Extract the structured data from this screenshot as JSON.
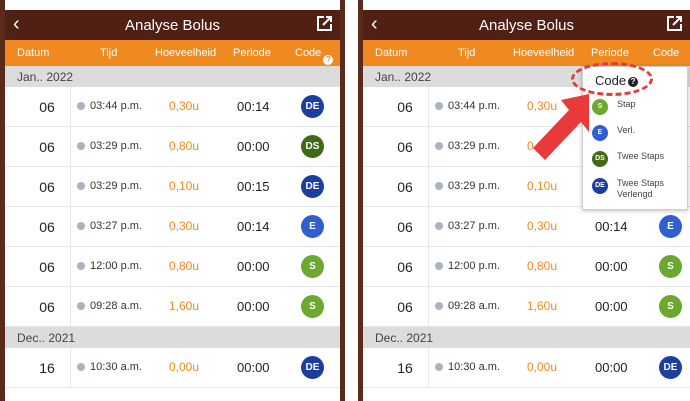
{
  "screens": [
    {
      "title": "Analyse Bolus",
      "headers": {
        "date": "Datum",
        "time": "Tijd",
        "amount": "Hoeveelheid",
        "period": "Periode",
        "code": "Code"
      },
      "sections": [
        {
          "label": "Jan.. 2022",
          "rows": [
            {
              "day": "06",
              "time": "03:44 p.m.",
              "amount": "0,30u",
              "period": "00:14",
              "code": "DE"
            },
            {
              "day": "06",
              "time": "03:29 p.m.",
              "amount": "0,80u",
              "period": "00:00",
              "code": "DS"
            },
            {
              "day": "06",
              "time": "03:29 p.m.",
              "amount": "0,10u",
              "period": "00:15",
              "code": "DE"
            },
            {
              "day": "06",
              "time": "03:27 p.m.",
              "amount": "0,30u",
              "period": "00:14",
              "code": "E"
            },
            {
              "day": "06",
              "time": "12:00 p.m.",
              "amount": "0,80u",
              "period": "00:00",
              "code": "S"
            },
            {
              "day": "06",
              "time": "09:28 a.m.",
              "amount": "1,60u",
              "period": "00:00",
              "code": "S"
            }
          ]
        },
        {
          "label": "Dec.. 2021",
          "rows": [
            {
              "day": "16",
              "time": "10:30 a.m.",
              "amount": "0,00u",
              "period": "00:00",
              "code": "DE"
            }
          ]
        }
      ]
    },
    {
      "title": "Analyse Bolus",
      "headers": {
        "date": "Datum",
        "time": "Tijd",
        "amount": "Hoeveelheid",
        "period": "Periode",
        "code": "Code"
      },
      "sections": [
        {
          "label": "Jan.. 2022",
          "rows": [
            {
              "day": "06",
              "time": "03:44 p.m.",
              "amount": "0,30u",
              "period": "",
              "code": ""
            },
            {
              "day": "06",
              "time": "03:29 p.m.",
              "amount": "0",
              "period": "",
              "code": ""
            },
            {
              "day": "06",
              "time": "03:29 p.m.",
              "amount": "0,10u",
              "period": "",
              "code": ""
            },
            {
              "day": "06",
              "time": "03:27 p.m.",
              "amount": "0,30u",
              "period": "00:14",
              "code": "E"
            },
            {
              "day": "06",
              "time": "12:00 p.m.",
              "amount": "0,80u",
              "period": "00:00",
              "code": "S"
            },
            {
              "day": "06",
              "time": "09:28 a.m.",
              "amount": "1,60u",
              "period": "00:00",
              "code": "S"
            }
          ]
        },
        {
          "label": "Dec.. 2021",
          "rows": [
            {
              "day": "16",
              "time": "10:30 a.m.",
              "amount": "0,00u",
              "period": "00:00",
              "code": "DE"
            }
          ]
        }
      ],
      "code_popup": {
        "title": "Code",
        "items": [
          {
            "code": "S",
            "label": "Stap"
          },
          {
            "code": "E",
            "label": "Verl."
          },
          {
            "code": "DS",
            "label": "Twee Staps"
          },
          {
            "code": "DE",
            "label": "Twee Staps Verlengd"
          }
        ]
      }
    }
  ],
  "colors": {
    "topbar": "#502014",
    "header_orange": "#f08a20",
    "amount_orange": "#ef8a1f",
    "code_S": "#6aa92e",
    "code_E": "#2f5fd0",
    "code_DS": "#3f6b15",
    "code_DE": "#1a3f9e",
    "annotation_red": "#e83a3a"
  },
  "icons": {
    "back": "chevron-left-icon",
    "share": "share-icon",
    "help": "question-circle-icon",
    "time": "clock-icon",
    "annotation": "arrow-pointer-icon"
  }
}
